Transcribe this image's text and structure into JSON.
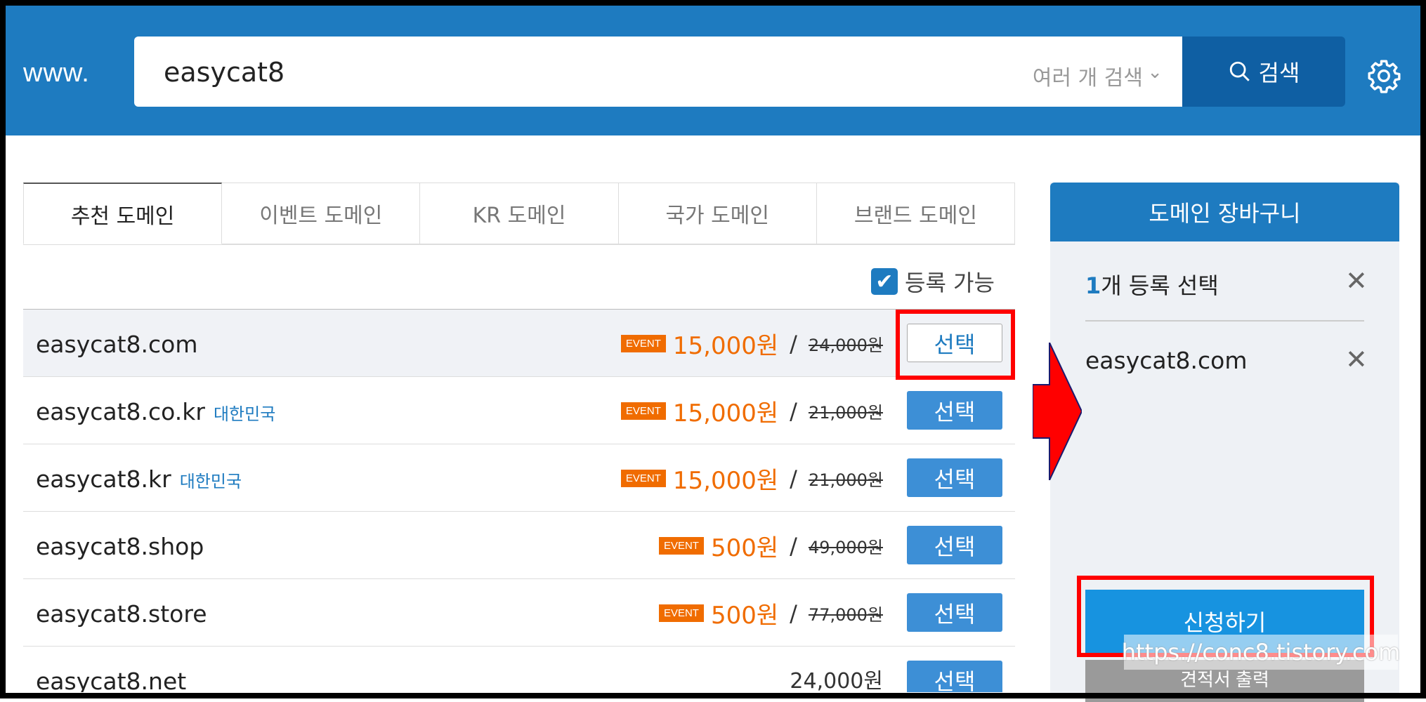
{
  "header": {
    "prefix": "www.",
    "search_value": "easycat8",
    "multi_search": "여러 개 검색",
    "search_button": "검색"
  },
  "tabs": [
    "추천 도메인",
    "이벤트 도메인",
    "KR 도메인",
    "국가 도메인",
    "브랜드 도메인"
  ],
  "filter": {
    "label": "등록 가능",
    "checked": true
  },
  "rows": [
    {
      "domain": "easycat8.com",
      "country": "",
      "event": "EVENT",
      "price": "15,000원",
      "old_price": "24,000원",
      "button": "선택"
    },
    {
      "domain": "easycat8.co.kr",
      "country": "대한민국",
      "event": "EVENT",
      "price": "15,000원",
      "old_price": "21,000원",
      "button": "선택"
    },
    {
      "domain": "easycat8.kr",
      "country": "대한민국",
      "event": "EVENT",
      "price": "15,000원",
      "old_price": "21,000원",
      "button": "선택"
    },
    {
      "domain": "easycat8.shop",
      "country": "",
      "event": "EVENT",
      "price": "500원",
      "old_price": "49,000원",
      "button": "선택"
    },
    {
      "domain": "easycat8.store",
      "country": "",
      "event": "EVENT",
      "price": "500원",
      "old_price": "77,000원",
      "button": "선택"
    },
    {
      "domain": "easycat8.net",
      "country": "",
      "price": "24,000원",
      "button": "선택"
    }
  ],
  "cart": {
    "title": "도메인 장바구니",
    "count": "1",
    "count_label": "개 등록 선택",
    "item": "easycat8.com",
    "apply_button": "신청하기",
    "quote_button": "견적서 출력"
  },
  "watermark": "https://conc8.tistory.com",
  "colors": {
    "brand_blue": "#1e7bc0",
    "event_orange": "#f06c00",
    "annotation_red": "#ff0000"
  }
}
